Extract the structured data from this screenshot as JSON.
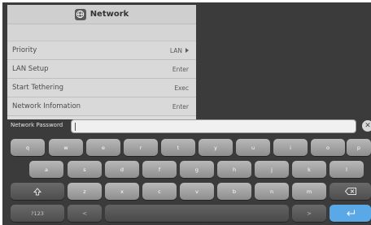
{
  "menu": {
    "title": "Network",
    "items": [
      {
        "label": "Priority",
        "value": "LAN"
      },
      {
        "label": "LAN Setup",
        "value": "Enter"
      },
      {
        "label": "Start Tethering",
        "value": "Exec"
      },
      {
        "label": "Network Infomation",
        "value": "Enter"
      }
    ]
  },
  "password": {
    "label": "Network Password",
    "value": ""
  },
  "keyboard": {
    "row1": [
      "q",
      "w",
      "e",
      "r",
      "t",
      "y",
      "u",
      "i",
      "o",
      "p"
    ],
    "row2": [
      "a",
      "s",
      "d",
      "f",
      "g",
      "h",
      "j",
      "k",
      "l"
    ],
    "row3": [
      "z",
      "x",
      "c",
      "v",
      "b",
      "n",
      "m"
    ],
    "num_key": "?123"
  },
  "colors": {
    "enter_key": "#5aa9e6",
    "background": "#3b3b3b"
  },
  "icons": {
    "title": "globe-icon",
    "priority": "chevron-right-icon",
    "clear": "close-icon",
    "shift": "shift-icon",
    "backspace": "backspace-icon",
    "globe_key": "chevron-right-icon",
    "enter": "enter-icon"
  }
}
